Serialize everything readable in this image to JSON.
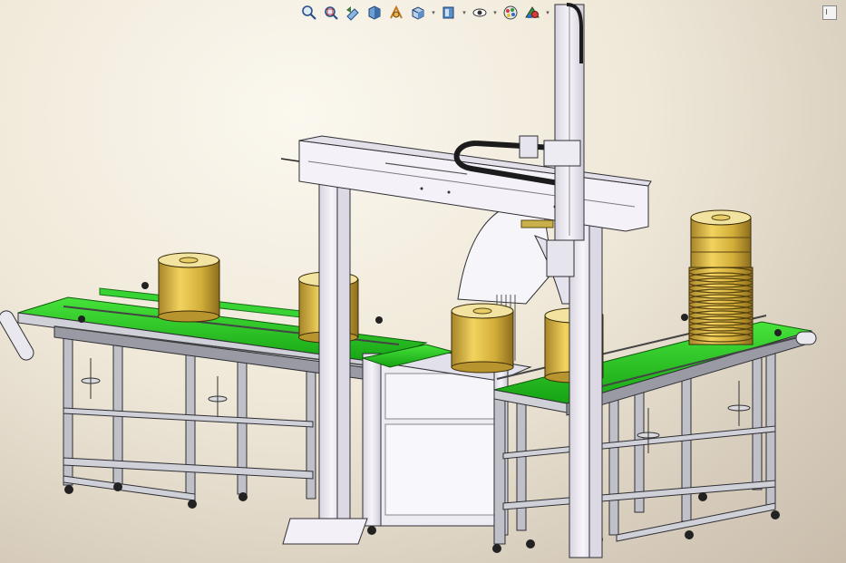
{
  "toolbar": {
    "items": [
      {
        "name": "zoom-to-fit-icon",
        "caret": false
      },
      {
        "name": "zoom-to-area-icon",
        "caret": false
      },
      {
        "name": "previous-view-icon",
        "caret": false
      },
      {
        "name": "section-view-icon",
        "caret": false
      },
      {
        "name": "dynamic-annotation-icon",
        "caret": false
      },
      {
        "name": "view-orientation-icon",
        "caret": true
      },
      {
        "name": "display-style-icon",
        "caret": true
      },
      {
        "name": "hide-show-items-icon",
        "caret": true
      },
      {
        "name": "edit-appearance-icon",
        "caret": false
      },
      {
        "name": "apply-scene-icon",
        "caret": true
      }
    ]
  },
  "colors": {
    "background": "#efe8d8",
    "frame": "#ece9f0",
    "belt": "#22c31f",
    "can": "#d7b43a",
    "rail": "#9a9aa4",
    "cable_chain": "#1b1b1b"
  },
  "panel_toggle": {
    "name": "task-pane-toggle-icon"
  }
}
